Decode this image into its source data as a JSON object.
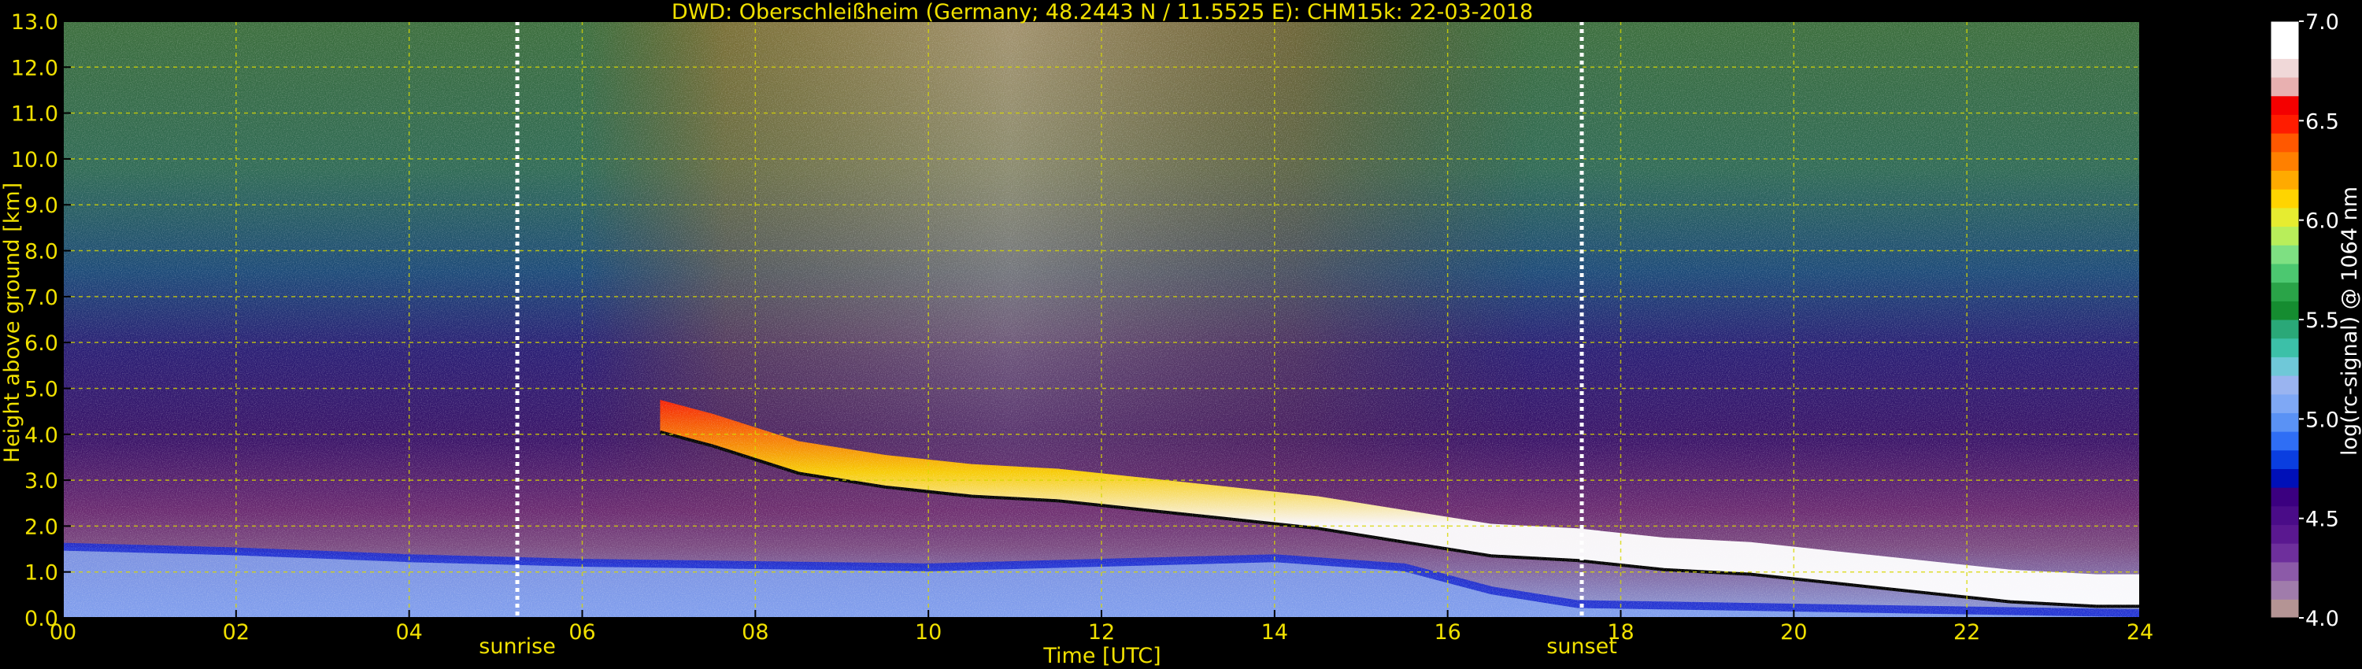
{
  "chart_data": {
    "type": "heatmap",
    "title": "DWD: Oberschleißheim (Germany; 48.2443 N / 11.5525 E):    CHM15k: 22-03-2018",
    "xlabel": "Time [UTC]",
    "ylabel": "Height above ground [km]",
    "xlim": [
      0,
      24
    ],
    "ylim": [
      0,
      13
    ],
    "x_ticks": [
      "00",
      "02",
      "04",
      "06",
      "08",
      "10",
      "12",
      "14",
      "16",
      "18",
      "20",
      "22",
      "24"
    ],
    "y_ticks": [
      "0.0",
      "1.0",
      "2.0",
      "3.0",
      "4.0",
      "5.0",
      "6.0",
      "7.0",
      "8.0",
      "9.0",
      "10.0",
      "11.0",
      "12.0",
      "13.0"
    ],
    "grid": true,
    "colorbar": {
      "label": "log(rc-signal) @ 1064 nm",
      "range": [
        4.0,
        7.0
      ],
      "ticks": [
        "4.0",
        "4.5",
        "5.0",
        "5.5",
        "6.0",
        "6.5",
        "7.0"
      ],
      "colors": [
        "#b49494",
        "#a07cab",
        "#8c5aa8",
        "#6e2f9c",
        "#5a1890",
        "#4a0c88",
        "#3b0080",
        "#0010b8",
        "#0a3ee0",
        "#2f6ef5",
        "#5a92f5",
        "#7fa8f5",
        "#9ab4f0",
        "#6fc8d8",
        "#3cc0a8",
        "#2aa878",
        "#158c30",
        "#2aa448",
        "#4cc870",
        "#7ee082",
        "#b8ee5a",
        "#e6ec30",
        "#ffd400",
        "#ffaa00",
        "#ff8000",
        "#ff5800",
        "#ff1c00",
        "#f40000",
        "#e8b0b0",
        "#f0d8d8",
        "#ffffff",
        "#ffffff"
      ]
    },
    "markers": [
      {
        "label": "sunrise",
        "x": 5.25
      },
      {
        "label": "sunset",
        "x": 17.55
      }
    ],
    "cloud_layers": [
      {
        "label": "",
        "points": [
          [
            6.9,
            4.4
          ],
          [
            7.5,
            4.1
          ],
          [
            8.5,
            3.5
          ],
          [
            9.5,
            3.2
          ],
          [
            10.5,
            3.0
          ],
          [
            11.5,
            2.9
          ],
          [
            12.5,
            2.7
          ],
          [
            13.5,
            2.5
          ],
          [
            14.5,
            2.3
          ],
          [
            15.5,
            2.0
          ],
          [
            16.5,
            1.7
          ],
          [
            17.5,
            1.6
          ],
          [
            18.5,
            1.4
          ],
          [
            19.5,
            1.3
          ],
          [
            20.5,
            1.1
          ],
          [
            21.5,
            0.9
          ],
          [
            22.5,
            0.7
          ],
          [
            23.5,
            0.6
          ],
          [
            24,
            0.6
          ]
        ]
      }
    ],
    "boundary_layer": {
      "points": [
        [
          0,
          1.55
        ],
        [
          2,
          1.45
        ],
        [
          4,
          1.3
        ],
        [
          6,
          1.2
        ],
        [
          8,
          1.15
        ],
        [
          10,
          1.1
        ],
        [
          12,
          1.2
        ],
        [
          14,
          1.3
        ],
        [
          15.5,
          1.1
        ],
        [
          16.5,
          0.6
        ],
        [
          17.5,
          0.3
        ],
        [
          24,
          0.1
        ]
      ]
    }
  }
}
